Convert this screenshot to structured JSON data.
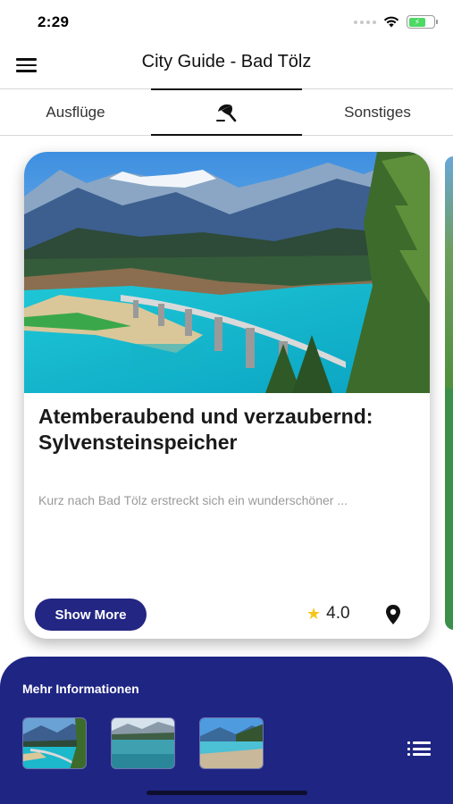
{
  "status_bar": {
    "time": "2:29"
  },
  "header": {
    "title": "City Guide - Bad Tölz",
    "menu_icon": "hamburger-menu-icon"
  },
  "tabs": [
    {
      "label": "Ausflüge",
      "active": false
    },
    {
      "label": "",
      "icon": "umbrella-beach-icon",
      "active": true
    },
    {
      "label": "Sonstiges",
      "active": false
    }
  ],
  "card": {
    "title": "Atemberaubend und verzaubernd: Sylvensteinspeicher",
    "description": "Kurz nach Bad Tölz erstreckt sich ein wunderschöner ...",
    "button_label": "Show More",
    "rating": "4.0",
    "rating_icon": "star-icon",
    "location_icon": "map-pin-icon"
  },
  "more_info": {
    "title": "Mehr Informationen",
    "list_icon": "list-icon",
    "thumbnails": 3
  },
  "colors": {
    "primary": "#232682",
    "panel": "#1f2583",
    "star": "#f5c518",
    "battery": "#4cd964"
  }
}
